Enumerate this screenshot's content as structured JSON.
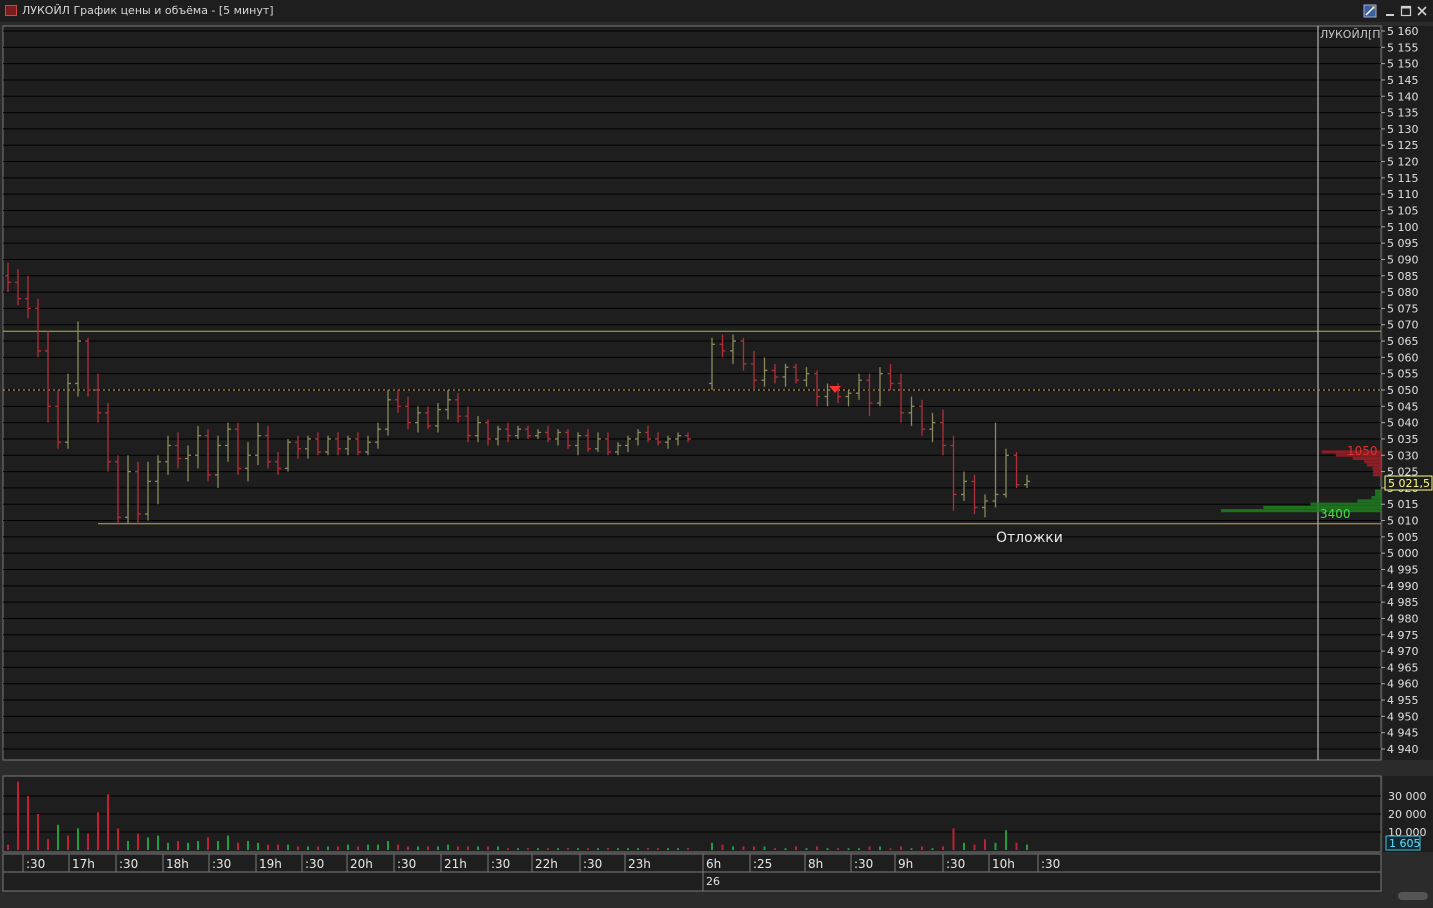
{
  "window": {
    "title": "ЛУКОЙЛ График цены и объёма - [5 минут]",
    "icons": [
      "settings-wand-icon",
      "minimize-icon",
      "maximize-icon",
      "close-icon"
    ]
  },
  "colors": {
    "background": "#1e1e1e",
    "grid": "#000000",
    "up_bar": "#8a8a5a",
    "down_bar": "#b0303a",
    "resistance": "#a0c040",
    "support": "#d0a040",
    "dotted_level": "#e0a040",
    "vol_up": "#1fa040",
    "vol_down": "#c02030",
    "ask_profile": "#a02028",
    "bid_profile": "#1f8020",
    "price_label": "#ffff80"
  },
  "chart": {
    "instrument_label": "ЛУКОЙЛ[П",
    "price_axis_labels": [
      "5 160",
      "5 155",
      "5 150",
      "5 145",
      "5 140",
      "5 135",
      "5 130",
      "5 125",
      "5 120",
      "5 115",
      "5 110",
      "5 105",
      "5 100",
      "5 095",
      "5 090",
      "5 085",
      "5 080",
      "5 075",
      "5 070",
      "5 065",
      "5 060",
      "5 055",
      "5 050",
      "5 045",
      "5 040",
      "5 035",
      "5 030",
      "5 025",
      "5 020",
      "5 015",
      "5 010",
      "5 005",
      "5 000",
      "4 995",
      "4 990",
      "4 985",
      "4 980",
      "4 975",
      "4 970",
      "4 965",
      "4 960",
      "4 955",
      "4 950",
      "4 945",
      "4 940"
    ],
    "current_price_label": "5 021,5",
    "resistance_level": 5068,
    "support_level": 5009,
    "dotted_level": 5050,
    "annotation": "Отложки",
    "ask_volume_label": "1050",
    "bid_volume_label": "3400"
  },
  "chart_data": {
    "type": "ohlc",
    "price_range": [
      4937,
      5161
    ],
    "bars": [
      {
        "o": 5085,
        "h": 5089,
        "l": 5080,
        "c": 5083
      },
      {
        "o": 5083,
        "h": 5087,
        "l": 5076,
        "c": 5078
      },
      {
        "o": 5078,
        "h": 5085,
        "l": 5072,
        "c": 5075
      },
      {
        "o": 5075,
        "h": 5078,
        "l": 5060,
        "c": 5062
      },
      {
        "o": 5062,
        "h": 5068,
        "l": 5040,
        "c": 5045
      },
      {
        "o": 5045,
        "h": 5050,
        "l": 5032,
        "c": 5034
      },
      {
        "o": 5034,
        "h": 5055,
        "l": 5032,
        "c": 5052
      },
      {
        "o": 5052,
        "h": 5071,
        "l": 5048,
        "c": 5065
      },
      {
        "o": 5065,
        "h": 5066,
        "l": 5048,
        "c": 5050
      },
      {
        "o": 5050,
        "h": 5055,
        "l": 5040,
        "c": 5043
      },
      {
        "o": 5043,
        "h": 5046,
        "l": 5025,
        "c": 5028
      },
      {
        "o": 5028,
        "h": 5030,
        "l": 5009,
        "c": 5011
      },
      {
        "o": 5011,
        "h": 5030,
        "l": 5009,
        "c": 5025
      },
      {
        "o": 5025,
        "h": 5028,
        "l": 5009,
        "c": 5012
      },
      {
        "o": 5012,
        "h": 5028,
        "l": 5010,
        "c": 5022
      },
      {
        "o": 5022,
        "h": 5030,
        "l": 5015,
        "c": 5028
      },
      {
        "o": 5028,
        "h": 5036,
        "l": 5024,
        "c": 5033
      },
      {
        "o": 5033,
        "h": 5037,
        "l": 5026,
        "c": 5029
      },
      {
        "o": 5029,
        "h": 5033,
        "l": 5022,
        "c": 5030
      },
      {
        "o": 5030,
        "h": 5039,
        "l": 5026,
        "c": 5036
      },
      {
        "o": 5036,
        "h": 5038,
        "l": 5022,
        "c": 5024
      },
      {
        "o": 5024,
        "h": 5036,
        "l": 5020,
        "c": 5033
      },
      {
        "o": 5033,
        "h": 5040,
        "l": 5028,
        "c": 5038
      },
      {
        "o": 5038,
        "h": 5040,
        "l": 5024,
        "c": 5026
      },
      {
        "o": 5026,
        "h": 5034,
        "l": 5022,
        "c": 5030
      },
      {
        "o": 5030,
        "h": 5040,
        "l": 5027,
        "c": 5036
      },
      {
        "o": 5036,
        "h": 5039,
        "l": 5026,
        "c": 5028
      },
      {
        "o": 5028,
        "h": 5031,
        "l": 5024,
        "c": 5026
      },
      {
        "o": 5026,
        "h": 5035,
        "l": 5025,
        "c": 5034
      },
      {
        "o": 5034,
        "h": 5036,
        "l": 5029,
        "c": 5032
      },
      {
        "o": 5032,
        "h": 5036,
        "l": 5029,
        "c": 5035
      },
      {
        "o": 5035,
        "h": 5037,
        "l": 5030,
        "c": 5031
      },
      {
        "o": 5031,
        "h": 5036,
        "l": 5030,
        "c": 5035
      },
      {
        "o": 5035,
        "h": 5037,
        "l": 5030,
        "c": 5032
      },
      {
        "o": 5032,
        "h": 5036,
        "l": 5030,
        "c": 5035
      },
      {
        "o": 5035,
        "h": 5037,
        "l": 5030,
        "c": 5031
      },
      {
        "o": 5031,
        "h": 5036,
        "l": 5030,
        "c": 5034
      },
      {
        "o": 5034,
        "h": 5040,
        "l": 5032,
        "c": 5038
      },
      {
        "o": 5038,
        "h": 5050,
        "l": 5036,
        "c": 5047
      },
      {
        "o": 5047,
        "h": 5050,
        "l": 5043,
        "c": 5045
      },
      {
        "o": 5045,
        "h": 5048,
        "l": 5038,
        "c": 5040
      },
      {
        "o": 5040,
        "h": 5045,
        "l": 5037,
        "c": 5043
      },
      {
        "o": 5043,
        "h": 5045,
        "l": 5038,
        "c": 5039
      },
      {
        "o": 5039,
        "h": 5046,
        "l": 5037,
        "c": 5044
      },
      {
        "o": 5044,
        "h": 5050,
        "l": 5041,
        "c": 5047
      },
      {
        "o": 5047,
        "h": 5049,
        "l": 5040,
        "c": 5042
      },
      {
        "o": 5042,
        "h": 5045,
        "l": 5034,
        "c": 5036
      },
      {
        "o": 5036,
        "h": 5042,
        "l": 5034,
        "c": 5040
      },
      {
        "o": 5040,
        "h": 5041,
        "l": 5033,
        "c": 5035
      },
      {
        "o": 5035,
        "h": 5039,
        "l": 5033,
        "c": 5038
      },
      {
        "o": 5038,
        "h": 5040,
        "l": 5034,
        "c": 5036
      },
      {
        "o": 5036,
        "h": 5039,
        "l": 5035,
        "c": 5038
      },
      {
        "o": 5038,
        "h": 5039,
        "l": 5035,
        "c": 5036
      },
      {
        "o": 5036,
        "h": 5038,
        "l": 5035,
        "c": 5037
      },
      {
        "o": 5037,
        "h": 5039,
        "l": 5034,
        "c": 5035
      },
      {
        "o": 5035,
        "h": 5038,
        "l": 5033,
        "c": 5037
      },
      {
        "o": 5037,
        "h": 5038,
        "l": 5032,
        "c": 5033
      },
      {
        "o": 5033,
        "h": 5037,
        "l": 5030,
        "c": 5036
      },
      {
        "o": 5036,
        "h": 5038,
        "l": 5031,
        "c": 5032
      },
      {
        "o": 5032,
        "h": 5037,
        "l": 5031,
        "c": 5035
      },
      {
        "o": 5035,
        "h": 5037,
        "l": 5030,
        "c": 5031
      },
      {
        "o": 5031,
        "h": 5034,
        "l": 5030,
        "c": 5033
      },
      {
        "o": 5033,
        "h": 5036,
        "l": 5031,
        "c": 5035
      },
      {
        "o": 5035,
        "h": 5038,
        "l": 5033,
        "c": 5037
      },
      {
        "o": 5037,
        "h": 5039,
        "l": 5034,
        "c": 5035
      },
      {
        "o": 5035,
        "h": 5037,
        "l": 5033,
        "c": 5034
      },
      {
        "o": 5034,
        "h": 5036,
        "l": 5032,
        "c": 5035
      },
      {
        "o": 5035,
        "h": 5037,
        "l": 5033,
        "c": 5036
      },
      {
        "o": 5036,
        "h": 5037,
        "l": 5034,
        "c": 5035
      },
      {
        "o": 5052,
        "h": 5066,
        "l": 5050,
        "c": 5064
      },
      {
        "o": 5064,
        "h": 5067,
        "l": 5060,
        "c": 5062
      },
      {
        "o": 5062,
        "h": 5067,
        "l": 5058,
        "c": 5065
      },
      {
        "o": 5065,
        "h": 5066,
        "l": 5056,
        "c": 5058
      },
      {
        "o": 5058,
        "h": 5062,
        "l": 5050,
        "c": 5053
      },
      {
        "o": 5053,
        "h": 5060,
        "l": 5051,
        "c": 5056
      },
      {
        "o": 5056,
        "h": 5058,
        "l": 5052,
        "c": 5054
      },
      {
        "o": 5054,
        "h": 5058,
        "l": 5051,
        "c": 5057
      },
      {
        "o": 5057,
        "h": 5058,
        "l": 5052,
        "c": 5053
      },
      {
        "o": 5053,
        "h": 5057,
        "l": 5051,
        "c": 5055
      },
      {
        "o": 5055,
        "h": 5056,
        "l": 5045,
        "c": 5048
      },
      {
        "o": 5048,
        "h": 5052,
        "l": 5045,
        "c": 5050
      },
      {
        "o": 5050,
        "h": 5052,
        "l": 5046,
        "c": 5048
      },
      {
        "o": 5048,
        "h": 5050,
        "l": 5045,
        "c": 5049
      },
      {
        "o": 5049,
        "h": 5055,
        "l": 5047,
        "c": 5053
      },
      {
        "o": 5053,
        "h": 5055,
        "l": 5042,
        "c": 5046
      },
      {
        "o": 5046,
        "h": 5057,
        "l": 5045,
        "c": 5055
      },
      {
        "o": 5055,
        "h": 5058,
        "l": 5050,
        "c": 5052
      },
      {
        "o": 5052,
        "h": 5055,
        "l": 5040,
        "c": 5043
      },
      {
        "o": 5043,
        "h": 5048,
        "l": 5039,
        "c": 5045
      },
      {
        "o": 5045,
        "h": 5047,
        "l": 5036,
        "c": 5038
      },
      {
        "o": 5038,
        "h": 5043,
        "l": 5034,
        "c": 5040
      },
      {
        "o": 5040,
        "h": 5044,
        "l": 5030,
        "c": 5033
      },
      {
        "o": 5033,
        "h": 5036,
        "l": 5013,
        "c": 5018
      },
      {
        "o": 5018,
        "h": 5025,
        "l": 5016,
        "c": 5022
      },
      {
        "o": 5022,
        "h": 5024,
        "l": 5012,
        "c": 5014
      },
      {
        "o": 5014,
        "h": 5018,
        "l": 5011,
        "c": 5016
      },
      {
        "o": 5016,
        "h": 5040,
        "l": 5014,
        "c": 5018
      },
      {
        "o": 5018,
        "h": 5032,
        "l": 5017,
        "c": 5030
      },
      {
        "o": 5030,
        "h": 5031,
        "l": 5020,
        "c": 5021
      },
      {
        "o": 5021,
        "h": 5024,
        "l": 5020,
        "c": 5022
      }
    ],
    "volume_axis_labels": [
      "30 000",
      "20 000",
      "10 000"
    ],
    "volume_range": [
      0,
      40000
    ],
    "current_volume_label": "1 605",
    "volume": [
      {
        "v": 3000,
        "d": "down"
      },
      {
        "v": 38000,
        "d": "down"
      },
      {
        "v": 30000,
        "d": "down"
      },
      {
        "v": 20000,
        "d": "down"
      },
      {
        "v": 6000,
        "d": "down"
      },
      {
        "v": 14000,
        "d": "up"
      },
      {
        "v": 8000,
        "d": "down"
      },
      {
        "v": 12000,
        "d": "up"
      },
      {
        "v": 9000,
        "d": "down"
      },
      {
        "v": 21000,
        "d": "down"
      },
      {
        "v": 31000,
        "d": "down"
      },
      {
        "v": 12000,
        "d": "down"
      },
      {
        "v": 5000,
        "d": "up"
      },
      {
        "v": 9000,
        "d": "down"
      },
      {
        "v": 7000,
        "d": "up"
      },
      {
        "v": 8000,
        "d": "up"
      },
      {
        "v": 4000,
        "d": "up"
      },
      {
        "v": 5000,
        "d": "down"
      },
      {
        "v": 4000,
        "d": "up"
      },
      {
        "v": 5000,
        "d": "up"
      },
      {
        "v": 7000,
        "d": "down"
      },
      {
        "v": 5000,
        "d": "up"
      },
      {
        "v": 8000,
        "d": "up"
      },
      {
        "v": 4000,
        "d": "down"
      },
      {
        "v": 5000,
        "d": "up"
      },
      {
        "v": 4000,
        "d": "up"
      },
      {
        "v": 3000,
        "d": "down"
      },
      {
        "v": 3000,
        "d": "down"
      },
      {
        "v": 3000,
        "d": "up"
      },
      {
        "v": 2000,
        "d": "down"
      },
      {
        "v": 2000,
        "d": "up"
      },
      {
        "v": 2000,
        "d": "down"
      },
      {
        "v": 2000,
        "d": "up"
      },
      {
        "v": 2000,
        "d": "down"
      },
      {
        "v": 3000,
        "d": "up"
      },
      {
        "v": 2000,
        "d": "down"
      },
      {
        "v": 3000,
        "d": "up"
      },
      {
        "v": 3000,
        "d": "up"
      },
      {
        "v": 5000,
        "d": "up"
      },
      {
        "v": 3000,
        "d": "down"
      },
      {
        "v": 2000,
        "d": "down"
      },
      {
        "v": 2000,
        "d": "up"
      },
      {
        "v": 2000,
        "d": "down"
      },
      {
        "v": 2000,
        "d": "up"
      },
      {
        "v": 3000,
        "d": "up"
      },
      {
        "v": 2000,
        "d": "down"
      },
      {
        "v": 2000,
        "d": "down"
      },
      {
        "v": 2000,
        "d": "up"
      },
      {
        "v": 2000,
        "d": "down"
      },
      {
        "v": 2000,
        "d": "up"
      },
      {
        "v": 1000,
        "d": "down"
      },
      {
        "v": 1000,
        "d": "up"
      },
      {
        "v": 1000,
        "d": "down"
      },
      {
        "v": 1000,
        "d": "up"
      },
      {
        "v": 1000,
        "d": "down"
      },
      {
        "v": 1000,
        "d": "up"
      },
      {
        "v": 1000,
        "d": "down"
      },
      {
        "v": 1000,
        "d": "up"
      },
      {
        "v": 1000,
        "d": "down"
      },
      {
        "v": 1000,
        "d": "up"
      },
      {
        "v": 1000,
        "d": "down"
      },
      {
        "v": 1000,
        "d": "up"
      },
      {
        "v": 1000,
        "d": "up"
      },
      {
        "v": 1000,
        "d": "up"
      },
      {
        "v": 1000,
        "d": "down"
      },
      {
        "v": 1000,
        "d": "down"
      },
      {
        "v": 1000,
        "d": "up"
      },
      {
        "v": 1000,
        "d": "up"
      },
      {
        "v": 1000,
        "d": "down"
      },
      {
        "v": 4000,
        "d": "up"
      },
      {
        "v": 3000,
        "d": "down"
      },
      {
        "v": 2000,
        "d": "up"
      },
      {
        "v": 2000,
        "d": "down"
      },
      {
        "v": 2000,
        "d": "down"
      },
      {
        "v": 2000,
        "d": "up"
      },
      {
        "v": 1000,
        "d": "down"
      },
      {
        "v": 1000,
        "d": "up"
      },
      {
        "v": 2000,
        "d": "down"
      },
      {
        "v": 1000,
        "d": "up"
      },
      {
        "v": 2000,
        "d": "down"
      },
      {
        "v": 1000,
        "d": "up"
      },
      {
        "v": 1000,
        "d": "down"
      },
      {
        "v": 1000,
        "d": "up"
      },
      {
        "v": 1000,
        "d": "up"
      },
      {
        "v": 2000,
        "d": "down"
      },
      {
        "v": 2000,
        "d": "up"
      },
      {
        "v": 1000,
        "d": "down"
      },
      {
        "v": 2000,
        "d": "down"
      },
      {
        "v": 1000,
        "d": "up"
      },
      {
        "v": 2000,
        "d": "down"
      },
      {
        "v": 1000,
        "d": "up"
      },
      {
        "v": 2000,
        "d": "down"
      },
      {
        "v": 12000,
        "d": "down"
      },
      {
        "v": 4000,
        "d": "up"
      },
      {
        "v": 3000,
        "d": "down"
      },
      {
        "v": 6000,
        "d": "down"
      },
      {
        "v": 4000,
        "d": "up"
      },
      {
        "v": 11000,
        "d": "up"
      },
      {
        "v": 4000,
        "d": "down"
      },
      {
        "v": 3000,
        "d": "up"
      }
    ],
    "time_axis_labels": [
      ":30",
      "17h",
      ":30",
      "18h",
      ":30",
      "19h",
      ":30",
      "20h",
      ":30",
      "21h",
      ":30",
      "22h",
      ":30",
      "23h",
      "6h",
      ":25",
      "8h",
      ":30",
      "9h",
      ":30",
      "10h",
      ":30"
    ],
    "date_label": "26",
    "ask_profile": [
      {
        "price": 5031,
        "volume": 1050
      },
      {
        "price": 5030,
        "volume": 800
      },
      {
        "price": 5029,
        "volume": 500
      },
      {
        "price": 5028,
        "volume": 300
      },
      {
        "price": 5027,
        "volume": 250
      },
      {
        "price": 5026,
        "volume": 150
      },
      {
        "price": 5025,
        "volume": 100
      },
      {
        "price": 5024,
        "volume": 50
      }
    ],
    "bid_profile": [
      {
        "price": 5019,
        "volume": 80
      },
      {
        "price": 5018,
        "volume": 120
      },
      {
        "price": 5017,
        "volume": 200
      },
      {
        "price": 5016,
        "volume": 500
      },
      {
        "price": 5015,
        "volume": 1500
      },
      {
        "price": 5014,
        "volume": 2500
      },
      {
        "price": 5013,
        "volume": 3400
      }
    ]
  }
}
